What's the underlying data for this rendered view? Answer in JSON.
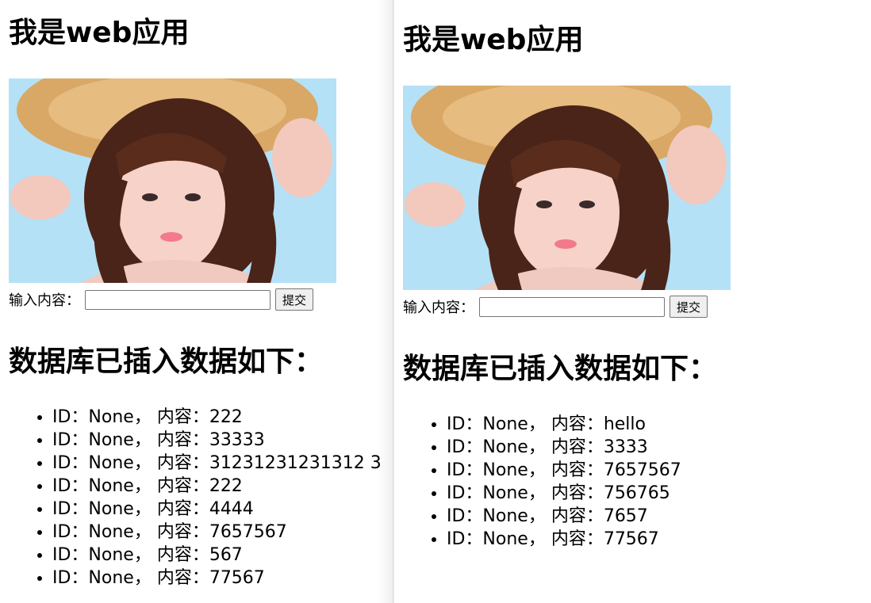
{
  "left_window": {
    "title": "我是web应用",
    "photo_alt": "girl-in-straw-hat",
    "input_label": "输入内容：",
    "input_value": "",
    "submit_label": "提交",
    "list_heading": "数据库已插入数据如下：",
    "records": [
      "ID：None， 内容：222",
      "ID：None， 内容：33333",
      "ID：None， 内容：31231231231312 3",
      "ID：None， 内容：222",
      "ID：None， 内容：4444",
      "ID：None， 内容：7657567",
      "ID：None， 内容：567",
      "ID：None， 内容：77567"
    ]
  },
  "right_window": {
    "title": "我是web应用",
    "photo_alt": "girl-in-straw-hat",
    "input_label": "输入内容：",
    "input_value": "",
    "submit_label": "提交",
    "list_heading": "数据库已插入数据如下：",
    "records": [
      "ID：None， 内容：hello",
      "ID：None， 内容：3333",
      "ID：None， 内容：7657567",
      "ID：None， 内容：756765",
      "ID：None， 内容：7657",
      "ID：None， 内容：77567"
    ]
  },
  "colors": {
    "photo_sky": "#a8dcf6",
    "hat": "#d9a866",
    "hair": "#4a2418",
    "skin": "#f6d2c8"
  }
}
